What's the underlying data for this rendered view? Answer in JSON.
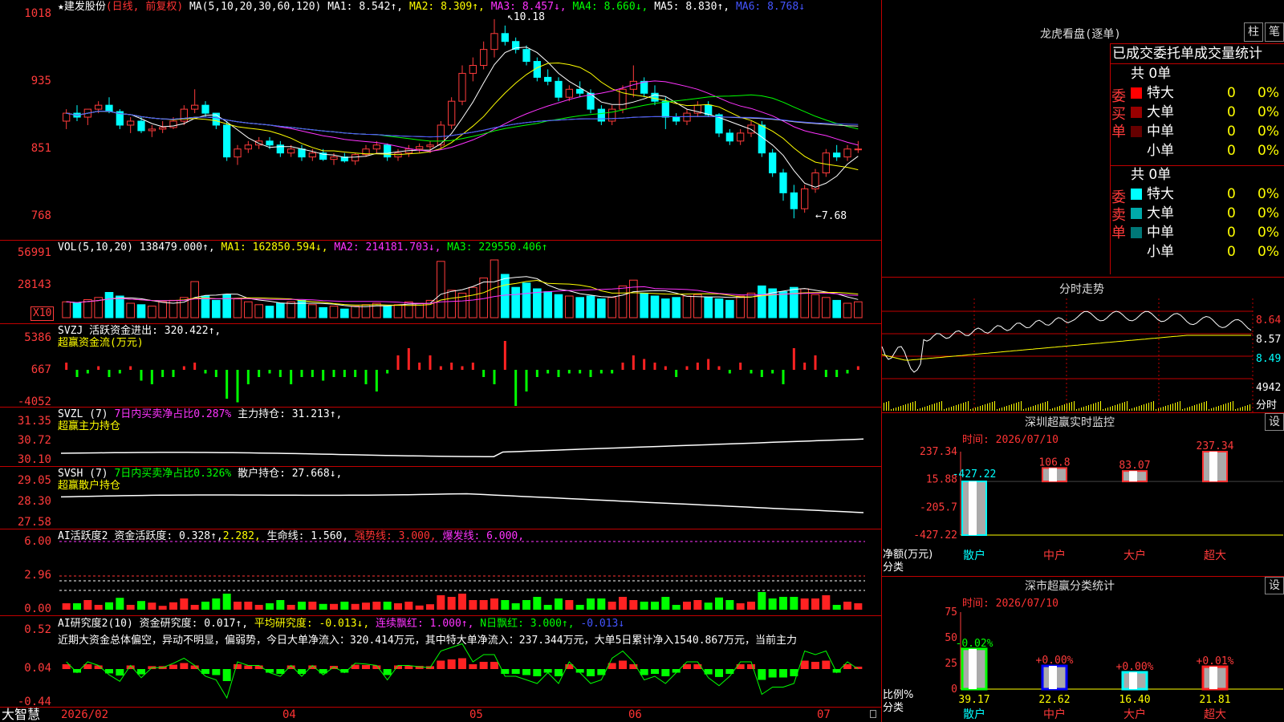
{
  "main_chart": {
    "legend": {
      "star": "★",
      "name": "建发股份",
      "period": "(日线, 前复权)",
      "ma_def": "MA(5,10,20,30,60,120)",
      "ma1": "MA1: 8.542↑,",
      "ma2": "MA2: 8.309↑,",
      "ma3": "MA3: 8.457↓,",
      "ma4": "MA4: 8.660↓,",
      "ma5": "MA5: 8.830↑,",
      "ma6": "MA6: 8.768↓"
    },
    "y_ticks": [
      "1018",
      "935",
      "851",
      "768"
    ],
    "annotation_high": "10.18",
    "annotation_low": "7.68",
    "candles": [
      [
        8.9,
        9.05,
        8.8,
        9.0
      ],
      [
        9.0,
        9.1,
        8.9,
        8.95
      ],
      [
        8.95,
        9.05,
        8.85,
        9.05
      ],
      [
        9.05,
        9.15,
        9.0,
        9.1
      ],
      [
        9.1,
        9.2,
        9.0,
        9.02
      ],
      [
        9.02,
        9.05,
        8.8,
        8.85
      ],
      [
        8.85,
        8.95,
        8.75,
        8.9
      ],
      [
        8.9,
        8.95,
        8.75,
        8.78
      ],
      [
        8.78,
        8.85,
        8.7,
        8.8
      ],
      [
        8.8,
        8.9,
        8.75,
        8.82
      ],
      [
        8.82,
        8.95,
        8.8,
        8.9
      ],
      [
        8.9,
        9.1,
        8.85,
        9.05
      ],
      [
        9.05,
        9.3,
        9.0,
        9.1
      ],
      [
        9.1,
        9.15,
        8.95,
        9.0
      ],
      [
        9.0,
        9.0,
        8.8,
        8.85
      ],
      [
        8.85,
        8.9,
        8.4,
        8.45
      ],
      [
        8.45,
        8.6,
        8.35,
        8.55
      ],
      [
        8.55,
        8.65,
        8.5,
        8.6
      ],
      [
        8.6,
        8.7,
        8.55,
        8.65
      ],
      [
        8.65,
        8.7,
        8.55,
        8.6
      ],
      [
        8.6,
        8.65,
        8.45,
        8.5
      ],
      [
        8.5,
        8.6,
        8.45,
        8.55
      ],
      [
        8.55,
        8.6,
        8.4,
        8.45
      ],
      [
        8.45,
        8.55,
        8.4,
        8.5
      ],
      [
        8.5,
        8.55,
        8.4,
        8.42
      ],
      [
        8.42,
        8.5,
        8.35,
        8.45
      ],
      [
        8.45,
        8.5,
        8.38,
        8.4
      ],
      [
        8.4,
        8.5,
        8.35,
        8.48
      ],
      [
        8.48,
        8.6,
        8.45,
        8.55
      ],
      [
        8.55,
        8.65,
        8.5,
        8.6
      ],
      [
        8.6,
        8.62,
        8.4,
        8.45
      ],
      [
        8.45,
        8.55,
        8.4,
        8.5
      ],
      [
        8.5,
        8.6,
        8.45,
        8.55
      ],
      [
        8.55,
        8.62,
        8.5,
        8.58
      ],
      [
        8.58,
        8.65,
        8.5,
        8.6
      ],
      [
        8.6,
        8.9,
        8.55,
        8.85
      ],
      [
        8.85,
        9.2,
        8.8,
        9.15
      ],
      [
        9.15,
        9.6,
        9.1,
        9.5
      ],
      [
        9.5,
        9.7,
        9.4,
        9.6
      ],
      [
        9.6,
        9.9,
        9.55,
        9.8
      ],
      [
        9.8,
        10.18,
        9.7,
        10.0
      ],
      [
        10.0,
        10.1,
        9.85,
        9.9
      ],
      [
        9.9,
        9.95,
        9.75,
        9.8
      ],
      [
        9.8,
        9.85,
        9.6,
        9.65
      ],
      [
        9.65,
        9.7,
        9.4,
        9.45
      ],
      [
        9.45,
        9.55,
        9.35,
        9.4
      ],
      [
        9.4,
        9.45,
        9.15,
        9.2
      ],
      [
        9.2,
        9.35,
        9.15,
        9.3
      ],
      [
        9.3,
        9.4,
        9.2,
        9.25
      ],
      [
        9.25,
        9.3,
        9.0,
        9.05
      ],
      [
        9.05,
        9.1,
        8.85,
        8.9
      ],
      [
        8.9,
        9.1,
        8.85,
        9.05
      ],
      [
        9.05,
        9.35,
        9.0,
        9.3
      ],
      [
        9.3,
        9.6,
        9.2,
        9.4
      ],
      [
        9.4,
        9.45,
        9.2,
        9.25
      ],
      [
        9.25,
        9.35,
        9.1,
        9.15
      ],
      [
        9.15,
        9.2,
        8.8,
        8.95
      ],
      [
        8.95,
        9.0,
        8.85,
        8.9
      ],
      [
        8.9,
        9.05,
        8.85,
        9.0
      ],
      [
        9.0,
        9.15,
        8.95,
        9.1
      ],
      [
        9.1,
        9.15,
        8.95,
        8.98
      ],
      [
        8.98,
        9.0,
        8.7,
        8.75
      ],
      [
        8.75,
        8.8,
        8.6,
        8.65
      ],
      [
        8.65,
        8.8,
        8.6,
        8.75
      ],
      [
        8.75,
        8.9,
        8.7,
        8.85
      ],
      [
        8.85,
        8.9,
        8.45,
        8.5
      ],
      [
        8.5,
        8.55,
        8.2,
        8.25
      ],
      [
        8.25,
        8.3,
        7.9,
        8.0
      ],
      [
        8.0,
        8.1,
        7.68,
        7.8
      ],
      [
        7.8,
        8.1,
        7.75,
        8.05
      ],
      [
        8.05,
        8.3,
        8.0,
        8.25
      ],
      [
        8.25,
        8.55,
        8.2,
        8.5
      ],
      [
        8.5,
        8.6,
        8.4,
        8.45
      ],
      [
        8.45,
        8.6,
        8.4,
        8.55
      ],
      [
        8.55,
        8.65,
        8.5,
        8.55
      ]
    ]
  },
  "vol_chart": {
    "legend": {
      "def": "VOL(5,10,20)",
      "v": "138479.000↑,",
      "ma1": "MA1: 162850.594↓,",
      "ma2": "MA2: 214181.703↓,",
      "ma3": "MA3: 229550.406↑"
    },
    "y_ticks": [
      "56991",
      "28143"
    ],
    "unit_box": "X10",
    "values": [
      22,
      20,
      25,
      28,
      35,
      30,
      20,
      18,
      16,
      22,
      24,
      28,
      50,
      30,
      24,
      32,
      26,
      22,
      18,
      16,
      20,
      22,
      24,
      18,
      14,
      16,
      12,
      16,
      18,
      20,
      16,
      18,
      22,
      20,
      24,
      78,
      38,
      34,
      42,
      55,
      80,
      60,
      42,
      48,
      40,
      36,
      32,
      30,
      28,
      30,
      26,
      28,
      44,
      52,
      34,
      30,
      26,
      28,
      30,
      32,
      28,
      26,
      24,
      30,
      34,
      44,
      40,
      36,
      42,
      40,
      32,
      28,
      24,
      20,
      22
    ]
  },
  "svzj": {
    "legend": {
      "def": "SVZJ",
      "label": "活跃资金进出: 320.422↑,",
      "title": "超赢资金流(万元)"
    },
    "y_ticks": [
      "5386",
      "667",
      "-4052"
    ],
    "values": [
      1,
      -1,
      -0.5,
      0.5,
      -1,
      -0.5,
      0.5,
      -1.5,
      -2,
      -1,
      -1,
      0.5,
      1,
      -0.5,
      -1,
      -4,
      -4.5,
      -2,
      -1,
      -0.5,
      -1,
      -2,
      -1,
      -1,
      -1.5,
      -1,
      -1,
      -1,
      -2,
      -3,
      -0.5,
      2,
      3,
      1,
      2,
      0.5,
      1,
      0.5,
      1,
      -1,
      -2,
      4,
      -5,
      -3,
      -1,
      -0.5,
      -1,
      -0.5,
      -0.5,
      -1,
      -0.5,
      -0.5,
      1,
      2,
      1.5,
      1,
      0.5,
      -1,
      0.5,
      1,
      1.5,
      0.5,
      -0.5,
      1,
      -0.5,
      -1,
      -0.5,
      -2,
      3,
      1,
      2,
      -1,
      -1,
      -0.5,
      0.5
    ]
  },
  "svzl": {
    "legend": {
      "def": "SVZL  (7)",
      "pct": "7日内买卖净占比0.287%",
      "label": "主力持仓: 31.213↑,",
      "title": "超赢主力持仓"
    },
    "y_ticks": [
      "31.35",
      "30.72",
      "30.10"
    ]
  },
  "svsh": {
    "legend": {
      "def": "SVSH  (7)",
      "pct": "7日内买卖净占比0.326%",
      "label": "散户持仓: 27.668↓,",
      "title": "超赢散户持仓"
    },
    "y_ticks": [
      "29.05",
      "28.30",
      "27.58"
    ]
  },
  "ai_active": {
    "legend": {
      "def": "AI活跃度2",
      "label1": "资金活跃度: 0.328↑,",
      "v2": "2.282,",
      "life": "生命线: 1.560,",
      "strong": "强势线: 3.000,",
      "burst": "爆发线: 6.000,"
    },
    "y_ticks": [
      "6.00",
      "2.96",
      "0.00"
    ]
  },
  "ai_research": {
    "legend": {
      "def": "AI研究度2(10)",
      "label1": "资金研究度: 0.017↑,",
      "avg": "平均研究度: -0.013↓,",
      "cont": "连续飘红: 1.000↑,",
      "nday": "N日飘红: 3.000↑,",
      "v5": "-0.013↓"
    },
    "commentary": "近期大资金总体偏空，异动不明显，偏弱势，今日大单净流入：320.414万元，其中特大单净流入：237.344万元，大单5日累计净入1540.867万元，当前主力",
    "y_ticks": [
      "0.52",
      "0.04",
      "-0.44"
    ]
  },
  "time_axis": {
    "brand": "大智慧",
    "labels": [
      "2026/02",
      "04",
      "05",
      "06",
      "07"
    ]
  },
  "right_panel": {
    "dragon": {
      "title": "龙虎看盘(逐单)",
      "btn1": "柱",
      "btn2": "笔",
      "subtitle": "已成交委托单成交量统计",
      "buy_label": "委买单",
      "sell_label": "委卖单",
      "buy_total": "共 0单",
      "sell_total": "共 0单",
      "buy_rows": [
        {
          "name": "特大",
          "count": "0",
          "pct": "0%",
          "color": "#ff0000"
        },
        {
          "name": "大单",
          "count": "0",
          "pct": "0%",
          "color": "#990000"
        },
        {
          "name": "中单",
          "count": "0",
          "pct": "0%",
          "color": "#660000"
        },
        {
          "name": "小单",
          "count": "0",
          "pct": "0%",
          "color": ""
        }
      ],
      "sell_rows": [
        {
          "name": "特大",
          "count": "0",
          "pct": "0%",
          "color": "#00ffff"
        },
        {
          "name": "大单",
          "count": "0",
          "pct": "0%",
          "color": "#00aaaa"
        },
        {
          "name": "中单",
          "count": "0",
          "pct": "0%",
          "color": "#007777"
        },
        {
          "name": "小单",
          "count": "0",
          "pct": "0%",
          "color": ""
        }
      ]
    },
    "intraday": {
      "title": "分时走势",
      "y_ticks": [
        "8.64",
        "8.57",
        "8.49"
      ],
      "vol_label": "4942",
      "vol_unit": "分时"
    },
    "sz_monitor": {
      "title": "深圳超赢实时监控",
      "settings": "设",
      "time": "时间: 2026/07/10",
      "y_ticks": [
        "237.34",
        "15.88",
        "-205.7",
        "-427.22"
      ],
      "axis_name": "净额(万元)",
      "axis_sub": "分类",
      "categories": [
        "散户",
        "中户",
        "大户",
        "超大"
      ],
      "values": [
        -427.22,
        106.8,
        83.07,
        237.34
      ],
      "value_labels": [
        "-427.22",
        "106.8",
        "83.07",
        "237.34"
      ]
    },
    "sz_class": {
      "title": "深市超赢分类统计",
      "settings": "设",
      "time": "时间: 2026/07/10",
      "y_ticks": [
        "75",
        "50",
        "25",
        "0"
      ],
      "axis_name": "比例%",
      "axis_sub": "分类",
      "categories": [
        "散户",
        "中户",
        "大户",
        "超大"
      ],
      "values": [
        39.17,
        22.62,
        16.4,
        21.81
      ],
      "value_labels": [
        "39.17",
        "22.62",
        "16.40",
        "21.81"
      ],
      "change_labels": [
        "-0.02%",
        "+0.00%",
        "+0.00%",
        "+0.01%"
      ]
    }
  }
}
